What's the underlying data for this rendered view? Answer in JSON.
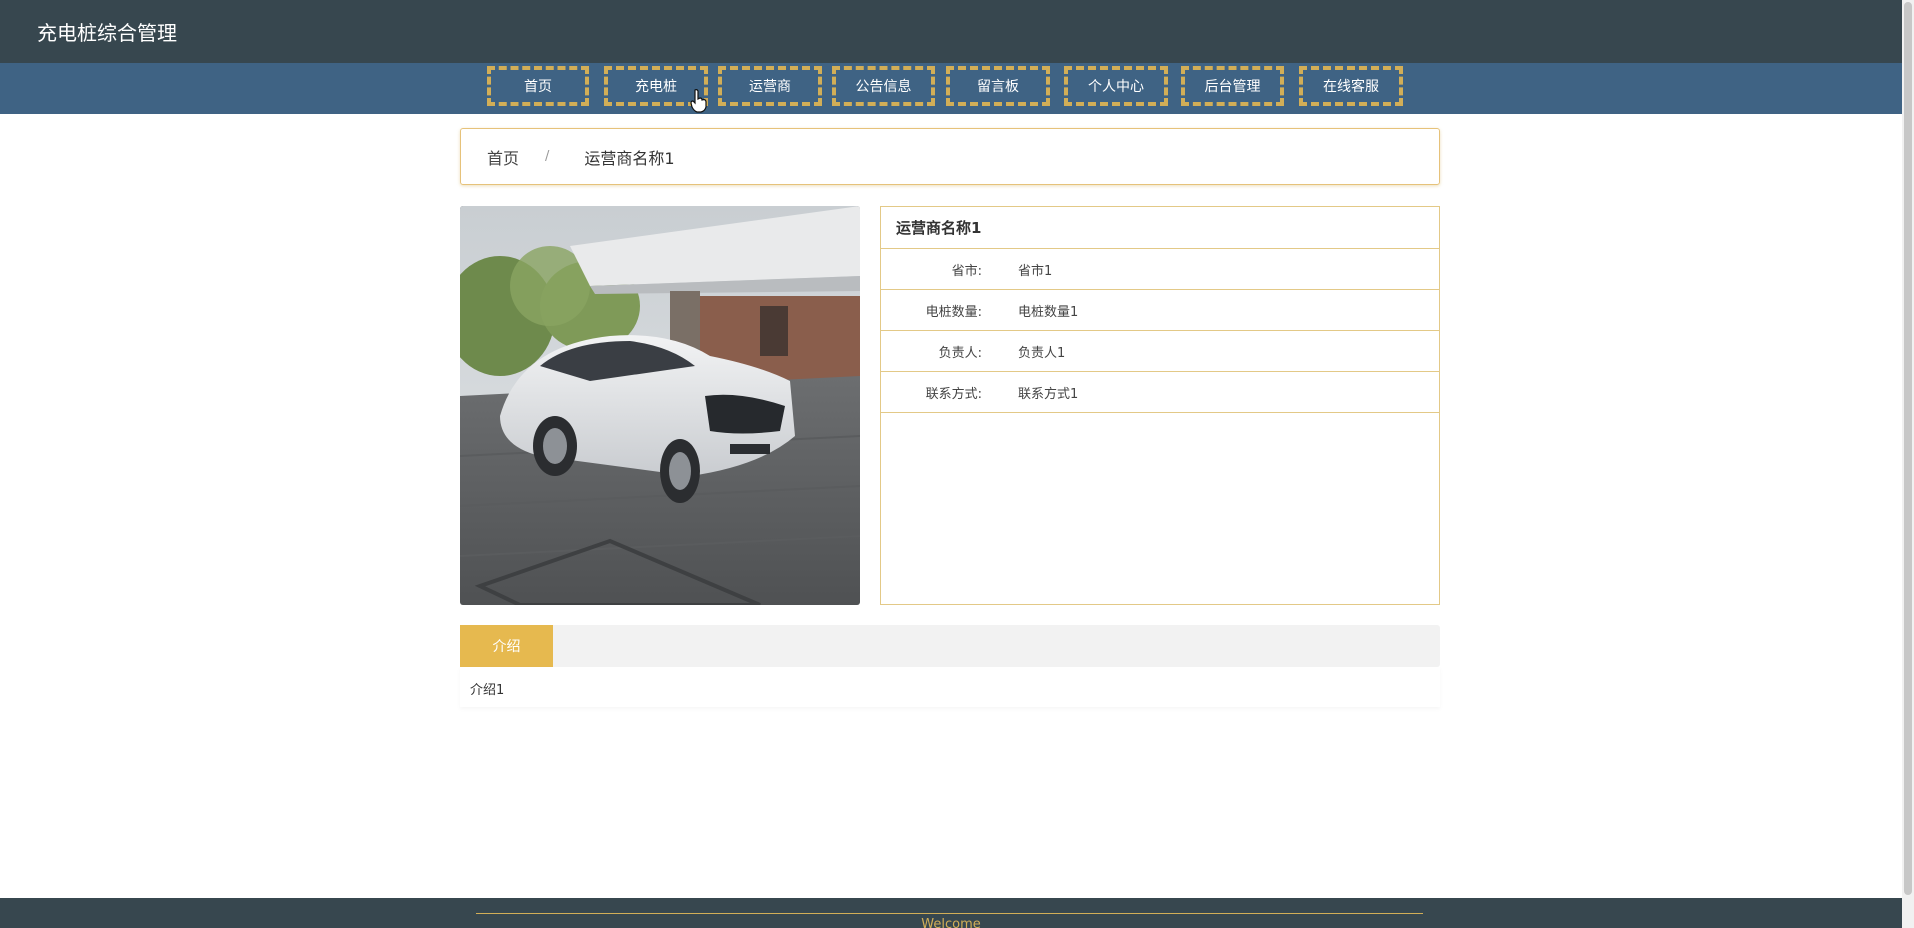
{
  "header": {
    "site_title": "充电桩综合管理"
  },
  "nav": {
    "items": [
      {
        "label": "首页"
      },
      {
        "label": "充电桩"
      },
      {
        "label": "运营商"
      },
      {
        "label": "公告信息"
      },
      {
        "label": "留言板"
      },
      {
        "label": "个人中心"
      },
      {
        "label": "后台管理"
      },
      {
        "label": "在线客服"
      }
    ]
  },
  "breadcrumb": {
    "home": "首页",
    "separator": "/",
    "current": "运营商名称1"
  },
  "detail": {
    "title": "运营商名称1",
    "fields": [
      {
        "label": "省市:",
        "value": "省市1"
      },
      {
        "label": "电桩数量:",
        "value": "电桩数量1"
      },
      {
        "label": "负责人:",
        "value": "负责人1"
      },
      {
        "label": "联系方式:",
        "value": "联系方式1"
      }
    ]
  },
  "tabs": {
    "active_label": "介绍"
  },
  "intro": {
    "content": "介绍1"
  },
  "footer": {
    "text": "Welcome"
  },
  "colors": {
    "topbar": "#37474f",
    "navbar": "#3f6384",
    "accent": "#d2ae57",
    "tab_active": "#e6b94f"
  },
  "icons": {
    "cursor": "hand-pointer-icon"
  }
}
